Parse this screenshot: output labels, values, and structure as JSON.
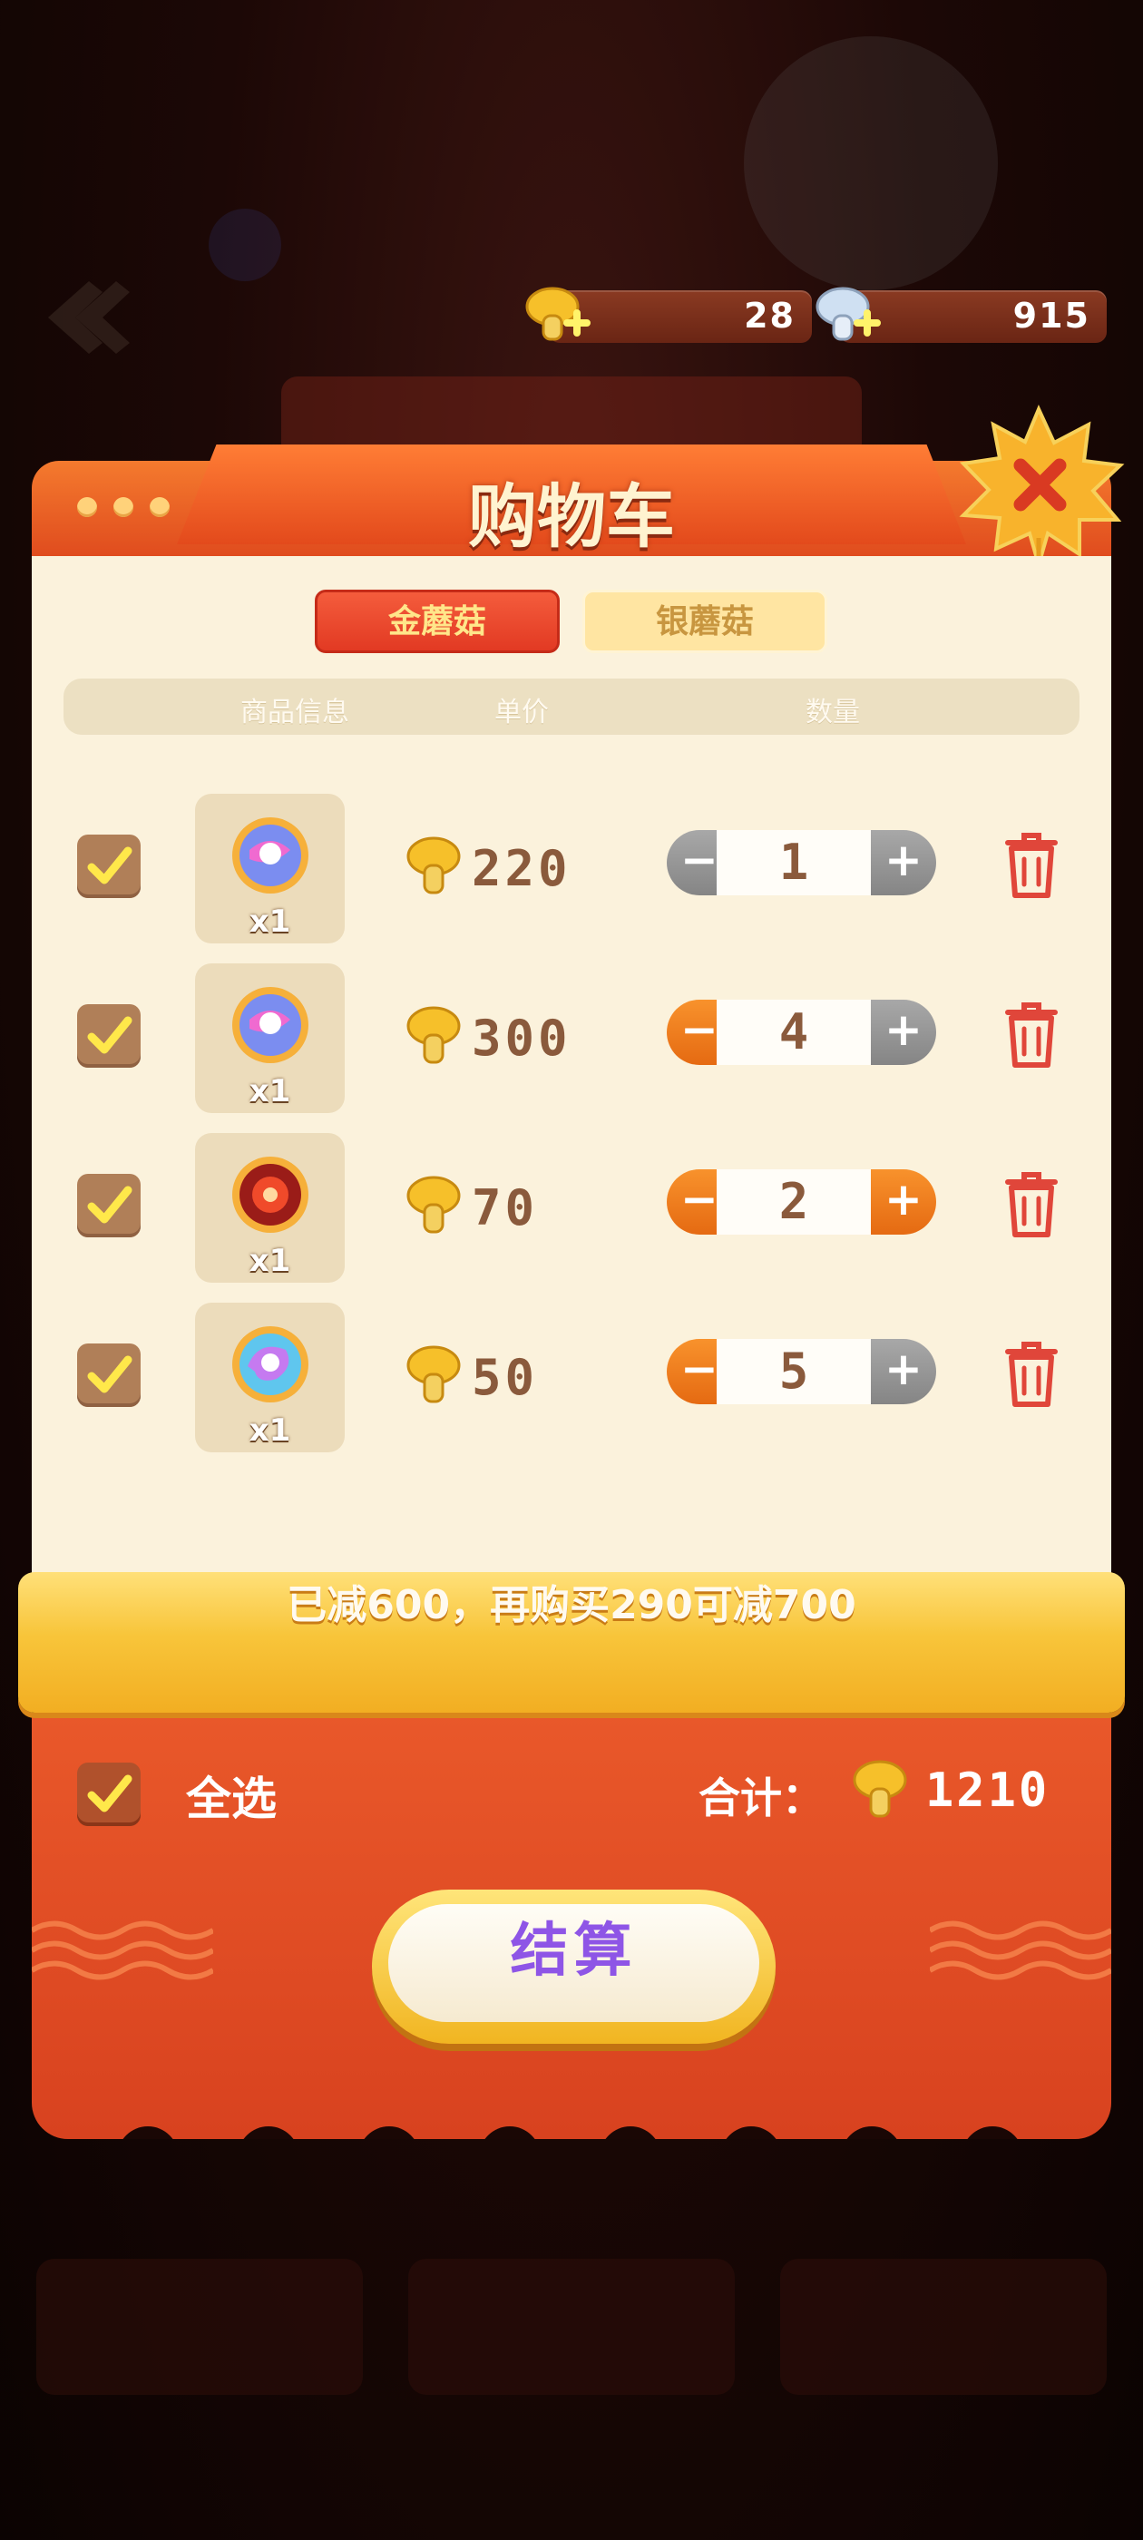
{
  "currencies": [
    {
      "icon": "gold-mushroom-add-icon",
      "value": "28"
    },
    {
      "icon": "silver-mushroom-add-icon",
      "value": "915"
    }
  ],
  "panel": {
    "title": "购物车",
    "tabs": [
      {
        "label": "金蘑菇",
        "selected": true
      },
      {
        "label": "银蘑菇",
        "selected": false
      }
    ],
    "columns": [
      "商品信息",
      "单价",
      "数量"
    ]
  },
  "cart_items": [
    {
      "checked": true,
      "icon": "blue-swirl-orb-icon",
      "qty_label": "x1",
      "price": "220",
      "quantity": "1",
      "minus_enabled": false,
      "plus_enabled": false
    },
    {
      "checked": true,
      "icon": "blue-swirl-orb-icon",
      "qty_label": "x1",
      "price": "300",
      "quantity": "4",
      "minus_enabled": true,
      "plus_enabled": false
    },
    {
      "checked": true,
      "icon": "red-sun-orb-icon",
      "qty_label": "x1",
      "price": "70",
      "quantity": "2",
      "minus_enabled": true,
      "plus_enabled": true
    },
    {
      "checked": true,
      "icon": "rainbow-swirl-orb-icon",
      "qty_label": "x1",
      "price": "50",
      "quantity": "5",
      "minus_enabled": true,
      "plus_enabled": false
    }
  ],
  "discount_banner": "已减600，再购买290可减700",
  "footer": {
    "select_all_label": "全选",
    "select_all_checked": true,
    "total_label": "合计：",
    "total_value": "1210",
    "checkout_label": "结算"
  },
  "colors": {
    "panel_orange": "#e04c1e",
    "panel_body": "#fbf2dc",
    "banner_gold": "#f8c53a",
    "checkout_text": "#8e55e6",
    "price_text": "#8a5a3c",
    "trash_red": "#e0463a"
  }
}
